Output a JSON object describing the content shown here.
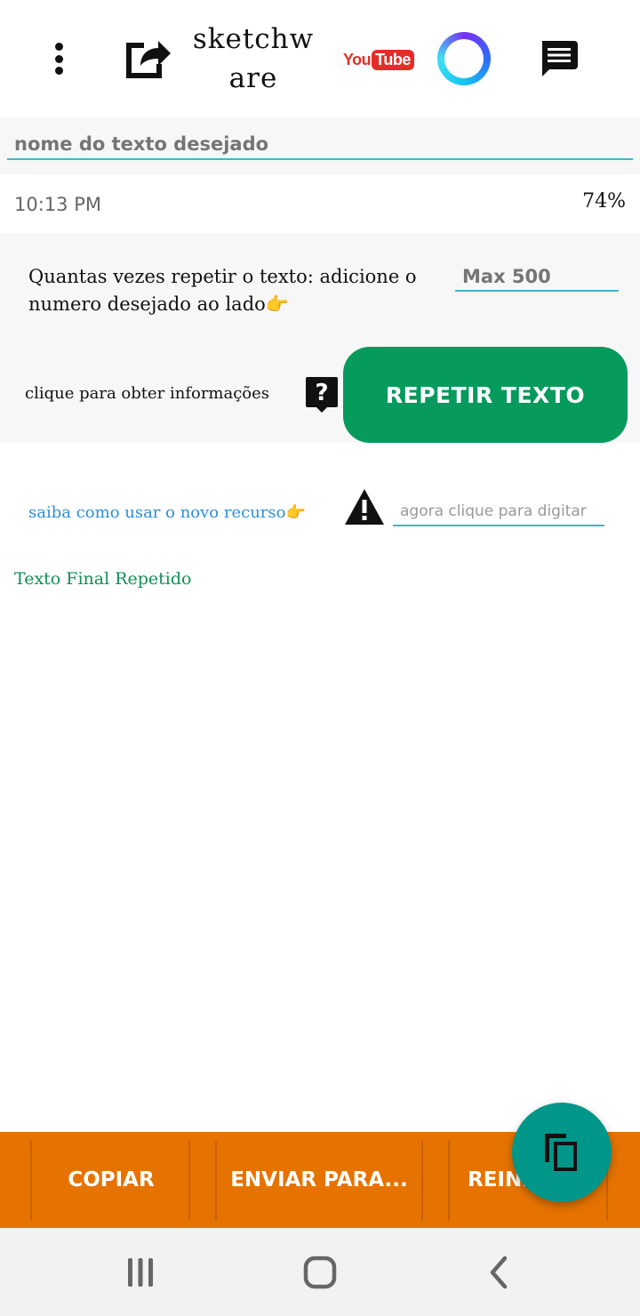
{
  "toolbar": {
    "app_title": "sketchware",
    "youtube_you": "You",
    "youtube_tube": "Tube"
  },
  "name_field": {
    "placeholder": "nome do texto desejado"
  },
  "status": {
    "time": "10:13 PM",
    "percent": "74%"
  },
  "repeat_panel": {
    "qty_label": "Quantas vezes repetir o texto: adicione o numero desejado ao lado👉",
    "qty_placeholder": "Max 500",
    "info_label": "clique para obter informações",
    "repeat_button": "REPETIR TEXTO"
  },
  "new_feature": {
    "learn_link": "saiba como usar o novo recurso👉",
    "type_placeholder": "agora clique para digitar"
  },
  "output": {
    "final_label": "Texto Final Repetido"
  },
  "bottom_bar": {
    "copy": "COPIAR",
    "send": "ENVIAR PARA...",
    "reset": "REINICIAR"
  },
  "colors": {
    "accent_green": "#069a5c",
    "bottom_bar_orange": "#e67300",
    "fab_teal": "#00968a",
    "underline_cyan": "#3bb8c9",
    "link_blue": "#2e8fd6"
  },
  "icons": {
    "menu": "more-vert-icon",
    "share": "share-icon",
    "youtube": "youtube-logo",
    "ring": "ring-icon",
    "chat": "message-icon",
    "help": "live-help-icon",
    "warning": "warning-icon",
    "fab": "copy-icon",
    "nav_recents": "recents-icon",
    "nav_home": "home-icon",
    "nav_back": "back-icon"
  }
}
